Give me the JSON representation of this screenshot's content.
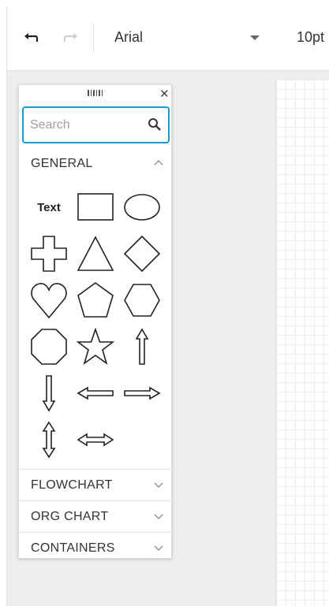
{
  "toolbar": {
    "font_name": "Arial",
    "font_size": "10pt"
  },
  "palette": {
    "search_placeholder": "Search",
    "sections": {
      "general": "GENERAL",
      "flowchart": "FLOWCHART",
      "org_chart": "ORG CHART",
      "containers": "CONTAINERS"
    },
    "text_shape_label": "Text"
  },
  "colors": {
    "accent": "#1a9bd7"
  }
}
